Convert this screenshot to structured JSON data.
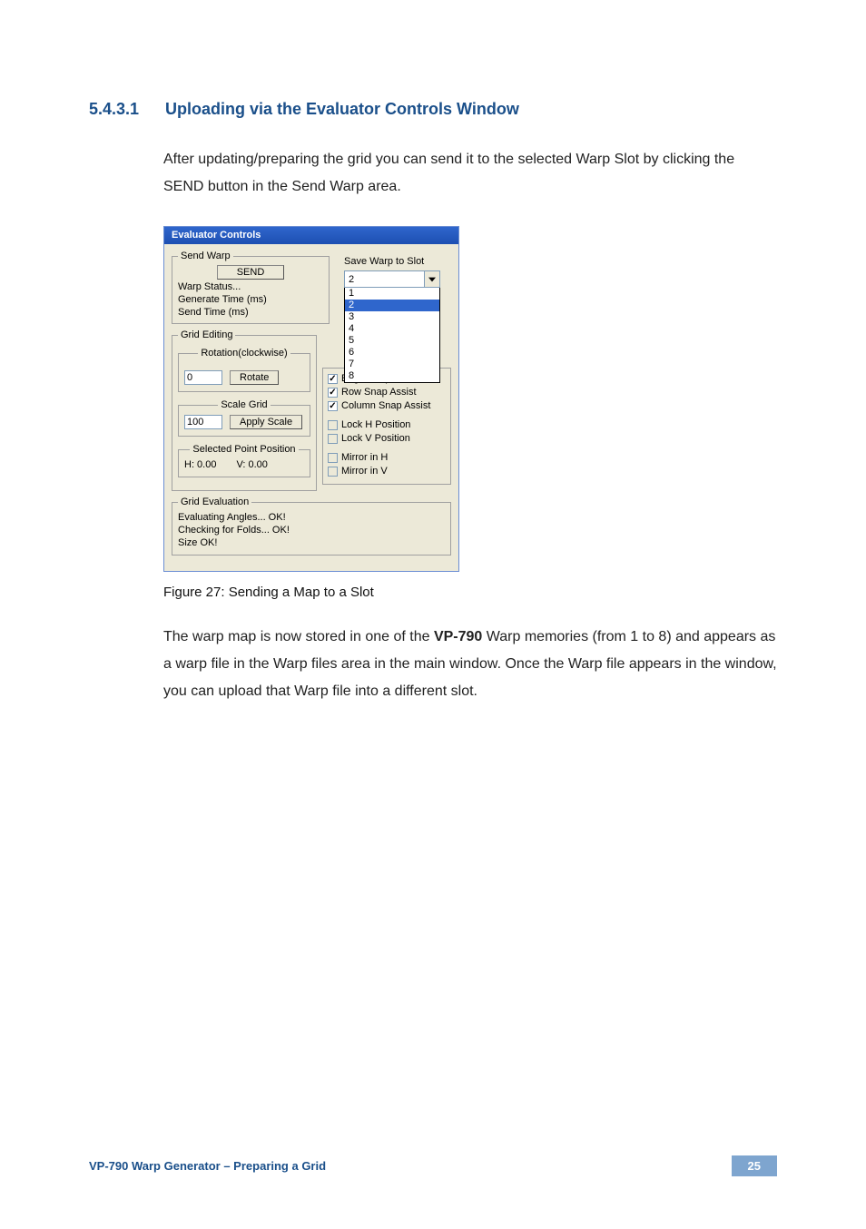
{
  "heading": {
    "number": "5.4.3.1",
    "title": "Uploading via the Evaluator Controls Window"
  },
  "para1": "After updating/preparing the grid you can send it to the selected Warp Slot by clicking the SEND button in the Send Warp area.",
  "win": {
    "title": "Evaluator Controls",
    "send_warp": {
      "legend": "Send Warp",
      "send_btn": "SEND",
      "warp_status": "Warp Status...",
      "gen_time": "Generate Time (ms)",
      "send_time": "Send Time (ms)"
    },
    "save_slot": {
      "label": "Save Warp to Slot",
      "selected": "2",
      "options": [
        "1",
        "2",
        "3",
        "4",
        "5",
        "6",
        "7",
        "8"
      ]
    },
    "grid_editing": {
      "legend": "Grid Editing",
      "rotation": {
        "legend": "Rotation(clockwise)",
        "value": "0",
        "btn": "Rotate"
      },
      "scale": {
        "legend": "Scale Grid",
        "value": "100",
        "btn": "Apply Scale"
      },
      "selpos": {
        "legend": "Selected Point Position",
        "h": "H:  0.00",
        "v": "V:  0.00"
      }
    },
    "checks": {
      "edge_snap": {
        "label": "Edge Snap Assist",
        "checked": true,
        "gray": false
      },
      "row_snap": {
        "label": "Row Snap Assist",
        "checked": true,
        "gray": false
      },
      "col_snap": {
        "label": "Column Snap Assist",
        "checked": true,
        "gray": false
      },
      "lock_h": {
        "label": "Lock H Position",
        "checked": false,
        "gray": true
      },
      "lock_v": {
        "label": "Lock V Position",
        "checked": false,
        "gray": true
      },
      "mirror_h": {
        "label": "Mirror in H",
        "checked": false,
        "gray": true
      },
      "mirror_v": {
        "label": "Mirror in V",
        "checked": false,
        "gray": true
      }
    },
    "grid_eval": {
      "legend": "Grid Evaluation",
      "l1": "Evaluating Angles... OK!",
      "l2": "Checking for Folds... OK!",
      "l3": "Size OK!"
    }
  },
  "figure_caption": "Figure 27: Sending a Map to a Slot",
  "para2_pre": "The warp map is now stored in one of the ",
  "para2_bold": "VP-790",
  "para2_post": " Warp memories (from 1 to 8) and appears as a warp file in the Warp files area in the main window. Once the Warp file appears in the window, you can upload that Warp file into a different slot.",
  "footer": {
    "left": "VP-790 Warp Generator – Preparing a Grid",
    "right": "25"
  }
}
